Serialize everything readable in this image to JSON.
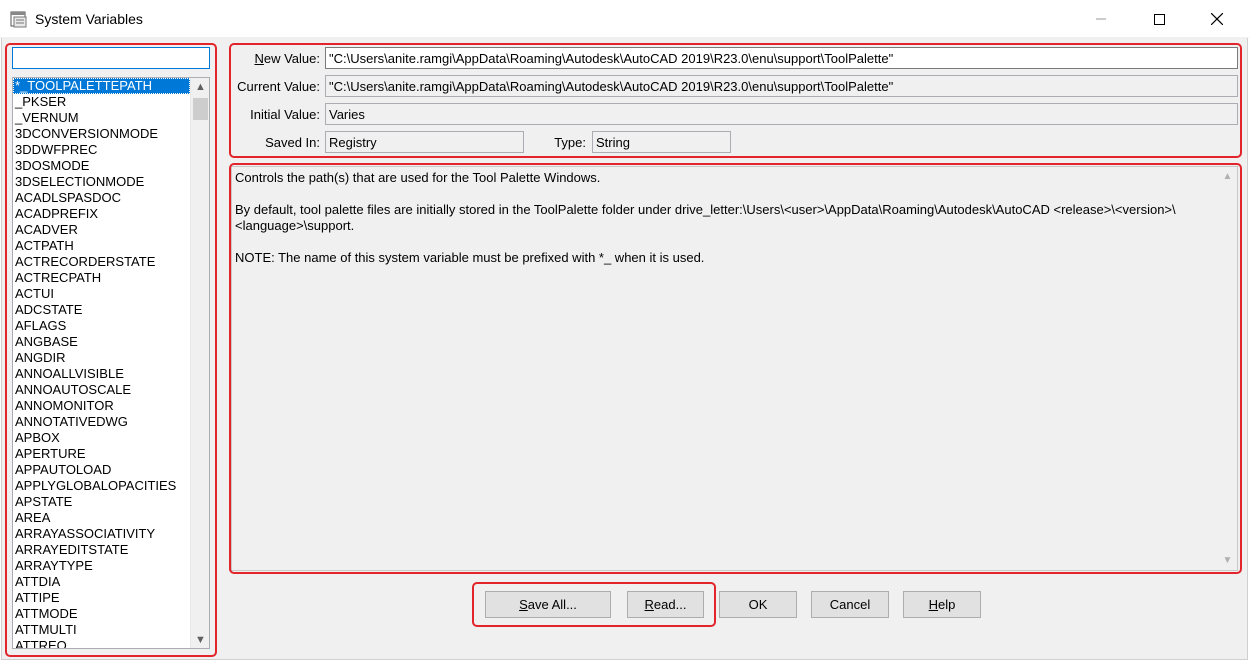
{
  "window": {
    "title": "System Variables",
    "icon": "app-window-icon"
  },
  "search": {
    "value": "",
    "placeholder": ""
  },
  "variables": [
    "*_TOOLPALETTEPATH",
    "_PKSER",
    "_VERNUM",
    "3DCONVERSIONMODE",
    "3DDWFPREC",
    "3DOSMODE",
    "3DSELECTIONMODE",
    "ACADLSPASDOC",
    "ACADPREFIX",
    "ACADVER",
    "ACTPATH",
    "ACTRECORDERSTATE",
    "ACTRECPATH",
    "ACTUI",
    "ADCSTATE",
    "AFLAGS",
    "ANGBASE",
    "ANGDIR",
    "ANNOALLVISIBLE",
    "ANNOAUTOSCALE",
    "ANNOMONITOR",
    "ANNOTATIVEDWG",
    "APBOX",
    "APERTURE",
    "APPAUTOLOAD",
    "APPLYGLOBALOPACITIES",
    "APSTATE",
    "AREA",
    "ARRAYASSOCIATIVITY",
    "ARRAYEDITSTATE",
    "ARRAYTYPE",
    "ATTDIA",
    "ATTIPE",
    "ATTMODE",
    "ATTMULTI",
    "ATTREQ"
  ],
  "selected_variable": "*_TOOLPALETTEPATH",
  "details": {
    "new_value_label_accel": "N",
    "new_value_label_rest": "ew Value:",
    "new_value": "\"C:\\Users\\anite.ramgi\\AppData\\Roaming\\Autodesk\\AutoCAD 2019\\R23.0\\enu\\support\\ToolPalette\"",
    "current_value_label": "Current Value:",
    "current_value": "\"C:\\Users\\anite.ramgi\\AppData\\Roaming\\Autodesk\\AutoCAD 2019\\R23.0\\enu\\support\\ToolPalette\"",
    "initial_value_label": "Initial Value:",
    "initial_value": "Varies",
    "saved_in_label": "Saved In:",
    "saved_in": "Registry",
    "type_label": "Type:",
    "type": "String"
  },
  "description": {
    "line1": "Controls the path(s) that are used for the Tool Palette Windows.",
    "line2": "By default, tool palette files are initially stored in the ToolPalette folder under drive_letter:\\Users\\<user>\\AppData\\Roaming\\Autodesk\\AutoCAD <release>\\<version>\\<language>\\support.",
    "line3": "NOTE: The name of this system variable must be prefixed with *_ when it is used."
  },
  "buttons": {
    "save_all_accel": "S",
    "save_all_rest": "ave All...",
    "read_accel": "R",
    "read_rest": "ead...",
    "ok": "OK",
    "cancel": "Cancel",
    "help_accel": "H",
    "help_rest": "elp"
  },
  "colors": {
    "highlight_box": "#e2252b",
    "selection": "#0078d7"
  }
}
